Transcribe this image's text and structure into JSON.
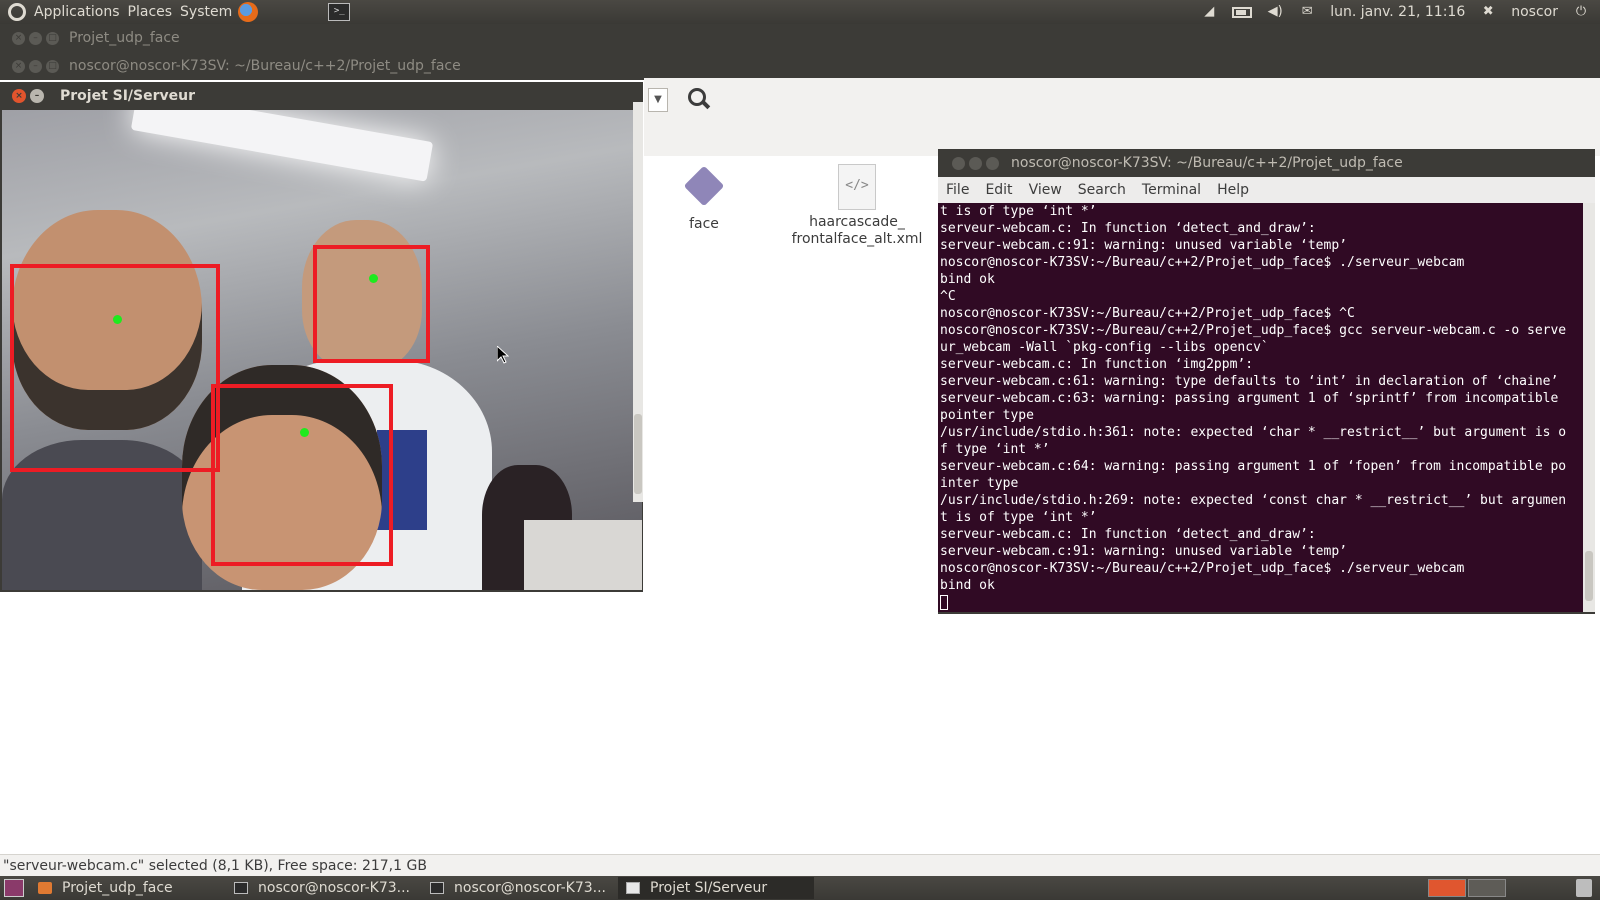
{
  "top_panel": {
    "menus": [
      "Applications",
      "Places",
      "System"
    ],
    "datetime": "lun. janv. 21, 11:16",
    "user": "noscor"
  },
  "windows": {
    "nautilus_title": "Projet_udp_face",
    "terminal_back_title": "noscor@noscor-K73SV: ~/Bureau/c++2/Projet_udp_face",
    "camera_title": "Projet SI/Serveur",
    "terminal_front_title": "noscor@noscor-K73SV: ~/Bureau/c++2/Projet_udp_face"
  },
  "files": [
    {
      "name": "face",
      "icon": "executable-icon"
    },
    {
      "name": "haarcascade_\nfrontalface_alt.xml",
      "icon": "xml-file-icon"
    }
  ],
  "terminal": {
    "menu": [
      "File",
      "Edit",
      "View",
      "Search",
      "Terminal",
      "Help"
    ],
    "lines": [
      "t is of type ‘int *’",
      "serveur-webcam.c: In function ‘detect_and_draw’:",
      "serveur-webcam.c:91: warning: unused variable ‘temp’",
      "noscor@noscor-K73SV:~/Bureau/c++2/Projet_udp_face$ ./serveur_webcam",
      "bind ok",
      "^C",
      "noscor@noscor-K73SV:~/Bureau/c++2/Projet_udp_face$ ^C",
      "noscor@noscor-K73SV:~/Bureau/c++2/Projet_udp_face$ gcc serveur-webcam.c -o serve",
      "ur_webcam -Wall `pkg-config --libs opencv`",
      "serveur-webcam.c: In function ‘img2ppm’:",
      "serveur-webcam.c:61: warning: type defaults to ‘int’ in declaration of ‘chaine’",
      "serveur-webcam.c:63: warning: passing argument 1 of ‘sprintf’ from incompatible",
      "pointer type",
      "/usr/include/stdio.h:361: note: expected ‘char * __restrict__’ but argument is o",
      "f type ‘int *’",
      "serveur-webcam.c:64: warning: passing argument 1 of ‘fopen’ from incompatible po",
      "inter type",
      "/usr/include/stdio.h:269: note: expected ‘const char * __restrict__’ but argumen",
      "t is of type ‘int *’",
      "serveur-webcam.c: In function ‘detect_and_draw’:",
      "serveur-webcam.c:91: warning: unused variable ‘temp’",
      "noscor@noscor-K73SV:~/Bureau/c++2/Projet_udp_face$ ./serveur_webcam",
      "bind ok"
    ]
  },
  "status_bar": "\"serveur-webcam.c\" selected (8,1 KB), Free space: 217,1 GB",
  "taskbar": [
    {
      "label": "Projet_udp_face",
      "icon": "folder-icon",
      "active": false
    },
    {
      "label": "noscor@noscor-K73...",
      "icon": "terminal-icon",
      "active": false
    },
    {
      "label": "noscor@noscor-K73...",
      "icon": "terminal-icon",
      "active": false
    },
    {
      "label": "Projet SI/Serveur",
      "icon": "window-icon",
      "active": true
    }
  ],
  "face_detections": 3,
  "colors": {
    "detection_box": "#ed1c24",
    "detection_center": "#1eea1e",
    "terminal_bg": "#300a24",
    "panel_bg": "#3c3b37"
  }
}
